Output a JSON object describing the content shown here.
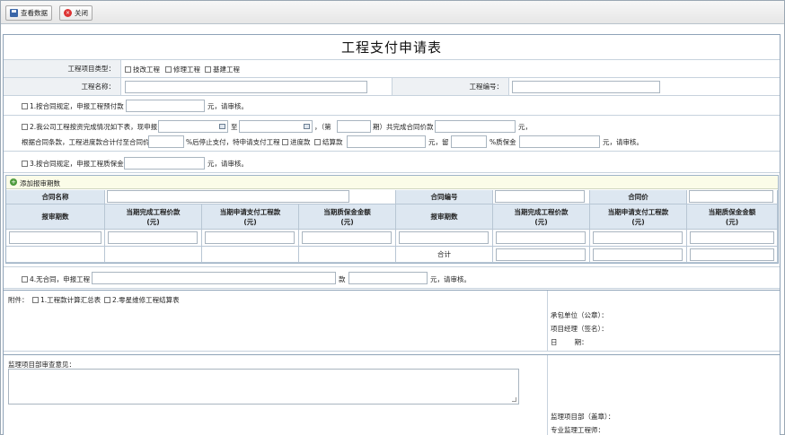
{
  "toolbar": {
    "view_label": "查看数据",
    "close_label": "关闭"
  },
  "form": {
    "title": "工程支付申请表",
    "project_type_label": "工程项目类型：",
    "project_types": [
      "技改工程",
      "修理工程",
      "基建工程"
    ],
    "project_name_label": "工程名称：",
    "project_no_label": "工程编号：",
    "opt1": {
      "label": "1.按合同规定，申报工程预付款",
      "suffix": "元，请审核。"
    },
    "opt2": {
      "label": "2.我公司工程按资完成情况如下表，现申报",
      "to": "至",
      "period_open": "，（第",
      "period_close": "期）共完成合同价款",
      "yuan": "元，",
      "line2_a": "根据合同条款，工程进度款合计付至合同价",
      "line2_b": "%后停止支付，特申请支付工程",
      "progress_label": "进度款",
      "settle_label": "结算款",
      "yuan_keep": "元，留",
      "warranty_pct": "%质保金",
      "suffix": "元，请审核。"
    },
    "opt3": {
      "label": "3.按合同规定，申报工程质保金",
      "suffix": "元，请审核。"
    },
    "sub": {
      "add_label": "添加报审期数",
      "contract_name": "合同名称",
      "contract_no": "合同编号",
      "contract_price": "合同价",
      "headers": [
        "报审期数",
        "当期完成工程价款\n(元)",
        "当期申请支付工程款\n(元)",
        "当期质保金金额\n(元)"
      ],
      "total_label": "合计"
    },
    "opt4": {
      "label": "4.无合同，申报工程",
      "kuan": "款",
      "suffix": "元，请审核。"
    },
    "attach": {
      "label": "附件：",
      "items": [
        "1.工程款计算汇总表",
        "2.零星维修工程结算表"
      ],
      "contractor": "承包单位（公章）：",
      "manager": "项目经理（签名）：",
      "date": "日        期："
    },
    "supervision": {
      "label": "监理项目部审查意见：",
      "dept": "监理项目部（盖章）：",
      "engineer": "专业监理工程师："
    }
  }
}
